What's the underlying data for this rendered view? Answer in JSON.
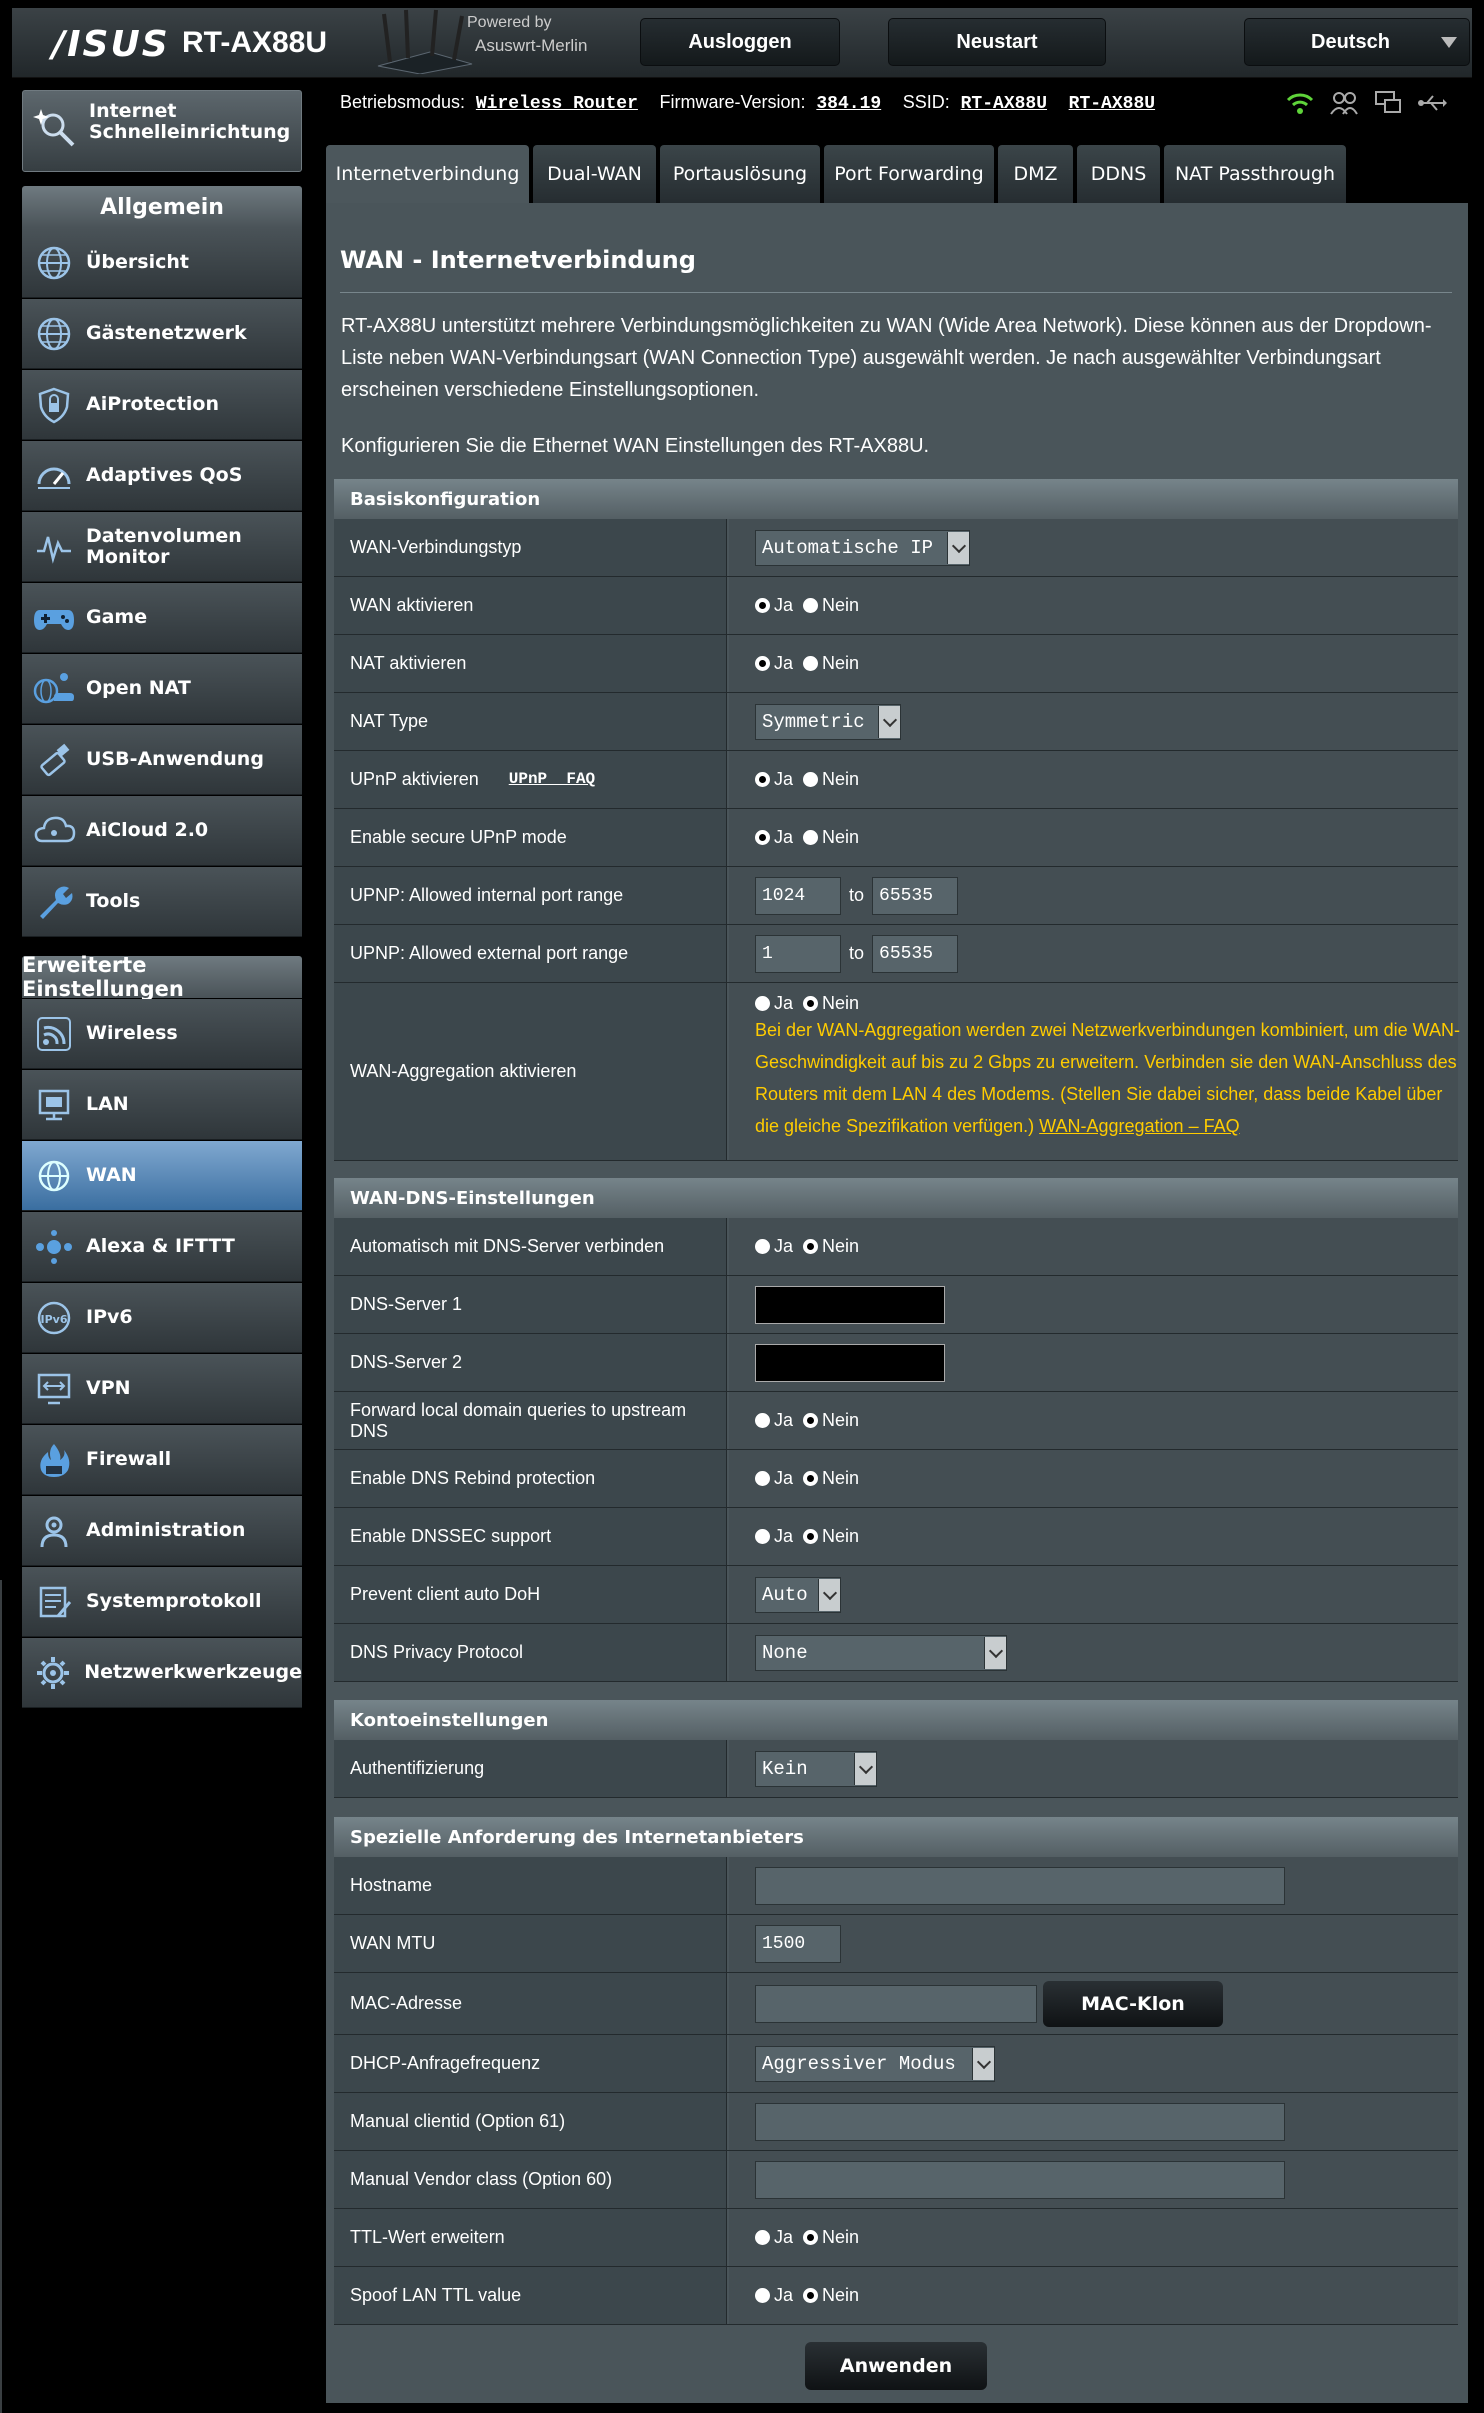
{
  "header": {
    "logo": "/ISUS",
    "model": "RT-AX88U",
    "powered_by": "Powered by",
    "firmware_brand": "Asuswrt-Merlin",
    "logout": "Ausloggen",
    "reboot": "Neustart",
    "language": "Deutsch"
  },
  "status": {
    "mode_label": "Betriebsmodus:",
    "mode": "Wireless Router",
    "fw_label": "Firmware-Version:",
    "fw": "384.19",
    "ssid_label": "SSID:",
    "ssid1": "RT-AX88U",
    "ssid2": "RT-AX88U"
  },
  "sidebar": {
    "qis": [
      "Internet",
      "Schnelleinrichtung"
    ],
    "general_head": "Allgemein",
    "general": [
      [
        "Übersicht"
      ],
      [
        "Gästenetzwerk"
      ],
      [
        "AiProtection"
      ],
      [
        "Adaptives QoS"
      ],
      [
        "Datenvolumen",
        "Monitor"
      ],
      [
        "Game"
      ],
      [
        "Open NAT"
      ],
      [
        "USB-Anwendung"
      ],
      [
        "AiCloud 2.0"
      ],
      [
        "Tools"
      ]
    ],
    "advanced_head": "Erweiterte Einstellungen",
    "advanced": [
      [
        "Wireless"
      ],
      [
        "LAN"
      ],
      [
        "WAN"
      ],
      [
        "Alexa & IFTTT"
      ],
      [
        "IPv6"
      ],
      [
        "VPN"
      ],
      [
        "Firewall"
      ],
      [
        "Administration"
      ],
      [
        "Systemprotokoll"
      ],
      [
        "Netzwerkwerkzeuge"
      ]
    ]
  },
  "tabs": [
    "Internetverbindung",
    "Dual-WAN",
    "Portauslösung",
    "Port Forwarding",
    "DMZ",
    "DDNS",
    "NAT Passthrough"
  ],
  "page": {
    "title": "WAN - Internetverbindung",
    "intro": "RT-AX88U unterstützt mehrere Verbindungsmöglichkeiten zu WAN (Wide Area Network). Diese können aus der Dropdown-Liste neben WAN-Verbindungsart (WAN Connection Type) ausgewählt werden. Je nach ausgewählter Verbindungsart erscheinen verschiedene Einstellungsoptionen.",
    "subintro": "Konfigurieren Sie die Ethernet WAN Einstellungen des RT-AX88U."
  },
  "radio": {
    "yes": "Ja",
    "no": "Nein",
    "to": "to"
  },
  "basic": {
    "head": "Basiskonfiguration",
    "wan_type_label": "WAN-Verbindungstyp",
    "wan_type_value": "Automatische IP",
    "wan_enable_label": "WAN aktivieren",
    "nat_enable_label": "NAT aktivieren",
    "nat_type_label": "NAT Type",
    "nat_type_value": "Symmetric",
    "upnp_label": "UPnP aktivieren",
    "upnp_faq": "UPnP  FAQ",
    "secure_upnp_label": "Enable secure UPnP mode",
    "int_range_label": "UPNP: Allowed internal port range",
    "int_from": "1024",
    "int_to": "65535",
    "ext_range_label": "UPNP: Allowed external port range",
    "ext_from": "1",
    "ext_to": "65535",
    "agg_label": "WAN-Aggregation aktivieren",
    "agg_note": "Bei der WAN-Aggregation werden zwei Netzwerkverbindungen kombiniert, um die WAN-Geschwindigkeit auf bis zu 2 Gbps zu erweitern. Verbinden sie den WAN-Anschluss des Routers mit dem LAN 4 des Modems. (Stellen Sie dabei sicher, dass beide Kabel über die gleiche Spezifikation verfügen.) ",
    "agg_faq": "WAN-Aggregation – FAQ"
  },
  "dns": {
    "head": "WAN-DNS-Einstellungen",
    "auto_label": "Automatisch mit DNS-Server verbinden",
    "dns1_label": "DNS-Server 1",
    "dns2_label": "DNS-Server 2",
    "forward_label": "Forward local domain queries to upstream DNS",
    "rebind_label": "Enable DNS Rebind protection",
    "dnssec_label": "Enable DNSSEC support",
    "doh_label": "Prevent client auto DoH",
    "doh_value": "Auto",
    "privacy_label": "DNS Privacy Protocol",
    "privacy_value": "None"
  },
  "account": {
    "head": "Kontoeinstellungen",
    "auth_label": "Authentifizierung",
    "auth_value": "Kein"
  },
  "isp": {
    "head": "Spezielle Anforderung des Internetanbieters",
    "hostname_label": "Hostname",
    "mtu_label": "WAN MTU",
    "mtu_value": "1500",
    "mac_label": "MAC-Adresse",
    "mac_clone": "MAC-Klon",
    "dhcp_label": "DHCP-Anfragefrequenz",
    "dhcp_value": "Aggressiver Modus",
    "clientid_label": "Manual clientid (Option 61)",
    "vendor_label": "Manual Vendor class (Option 60)",
    "ttl_label": "TTL-Wert erweitern",
    "spoof_label": "Spoof LAN TTL value"
  },
  "apply": "Anwenden",
  "colors": {
    "accent_active": "#3a6ea0",
    "note": "#ffcc00",
    "wifi": "#5fd43a"
  }
}
